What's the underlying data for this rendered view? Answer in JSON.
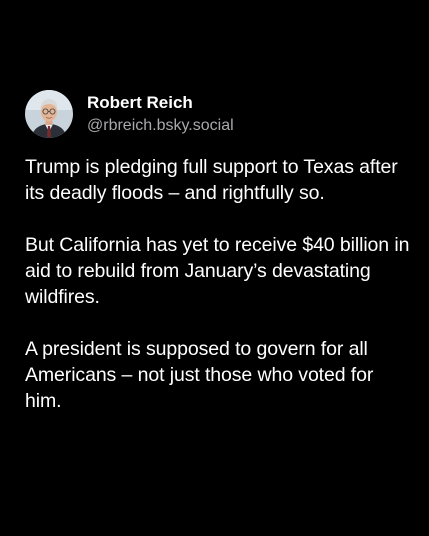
{
  "post": {
    "author": {
      "display_name": "Robert Reich",
      "handle": "@rbreich.bsky.social",
      "avatar_icon": "profile-photo"
    },
    "paragraphs": [
      "Trump is pledging full support to Texas after its deadly floods – and rightfully so.",
      "But California has yet to receive $40 billion in aid to rebuild from January’s devastating wildfires.",
      "A president is supposed to govern for all Americans – not just those who voted for him."
    ]
  },
  "colors": {
    "background": "#000000",
    "text": "#ffffff",
    "handle": "#a9a9ad"
  }
}
